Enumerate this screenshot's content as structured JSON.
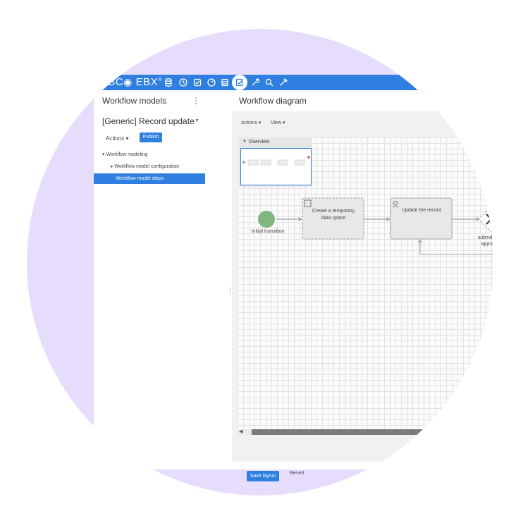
{
  "brand": {
    "logo_text": "TIBC",
    "logo_text2": "EBX",
    "trademark": "®"
  },
  "toolbar": {
    "icons": [
      "database-icon",
      "clock-icon",
      "checklist-icon",
      "dashboard-icon",
      "stack-icon",
      "workflow-icon",
      "wrench-icon",
      "search-icon",
      "tool-icon"
    ]
  },
  "left_panel": {
    "header": "Workflow models",
    "record_title": "[Generic] Record update",
    "actions_label": "Actions",
    "publish_label": "Publish",
    "tree": {
      "root": "Workflow modeling",
      "child1": "Workflow model configuration",
      "child2": "Workflow model steps"
    }
  },
  "right_panel": {
    "header": "Workflow diagram",
    "actions_label": "Actions",
    "view_label": "View",
    "overview_label": "Overview"
  },
  "diagram": {
    "start_label": "Initial transition",
    "task1_label": "Create a temporary data space",
    "task2_label": "Update the record",
    "gateway_label": "submitted for approval?"
  },
  "footer": {
    "save_label": "Save layout",
    "revert_label": "Revert"
  },
  "colors": {
    "accent": "#2e7fe0",
    "background_circle": "#e6ddfc",
    "start_node": "#7fb77e"
  }
}
